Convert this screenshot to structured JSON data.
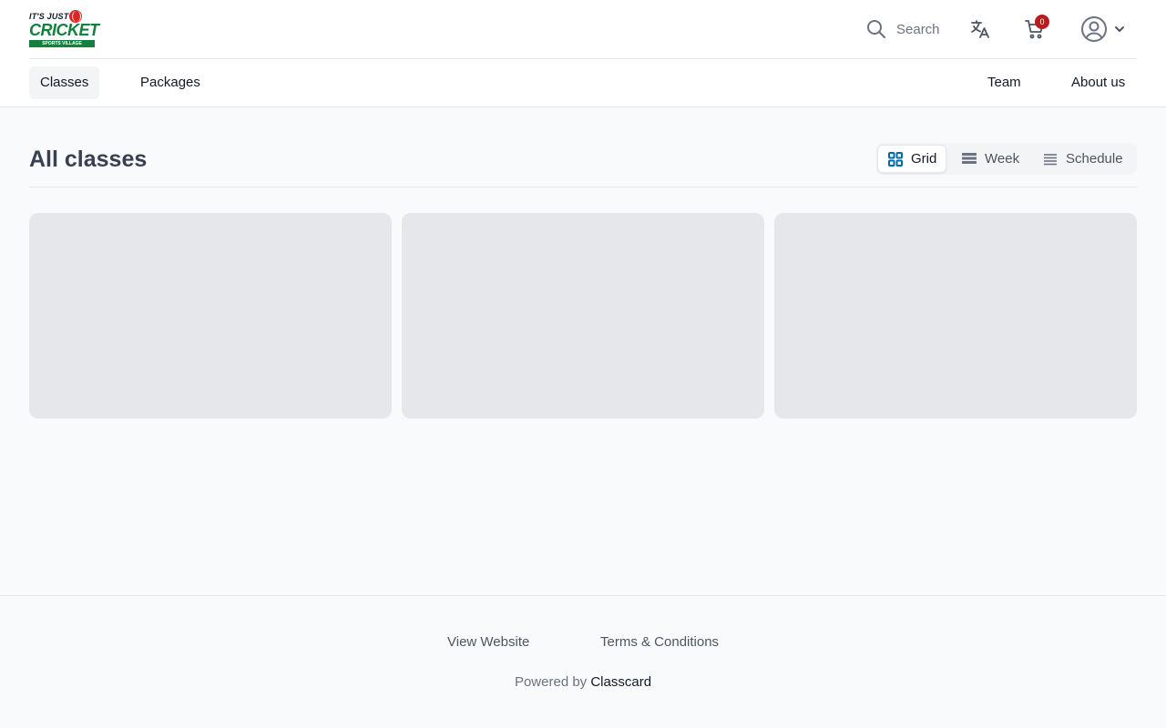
{
  "logo": {
    "line1": "IT'S JUST",
    "line2": "CRICKET",
    "band": "SPORTS VILLAGE"
  },
  "header": {
    "search_label": "Search",
    "cart_count": "0",
    "icons": {
      "search": "search-icon",
      "translate": "translate-icon",
      "cart": "cart-icon",
      "account": "user-circle-icon",
      "account_menu": "chevron-down-icon"
    }
  },
  "nav": {
    "left": [
      {
        "label": "Classes",
        "active": true
      },
      {
        "label": "Packages",
        "active": false
      }
    ],
    "right": [
      {
        "label": "Team"
      },
      {
        "label": "About us"
      }
    ]
  },
  "main": {
    "title": "All classes",
    "views": [
      {
        "label": "Grid",
        "icon": "grid-icon",
        "active": true
      },
      {
        "label": "Week",
        "icon": "week-icon",
        "active": false
      },
      {
        "label": "Schedule",
        "icon": "list-icon",
        "active": false
      }
    ]
  },
  "footer": {
    "links": [
      "View Website",
      "Terms & Conditions"
    ],
    "powered_prefix": "Powered by",
    "powered_brand": "Classcard"
  },
  "colors": {
    "brand_green": "#15803d",
    "badge_red": "#b91c1c",
    "active_blue": "#0369a1",
    "skeleton": "#e5e7eb"
  }
}
